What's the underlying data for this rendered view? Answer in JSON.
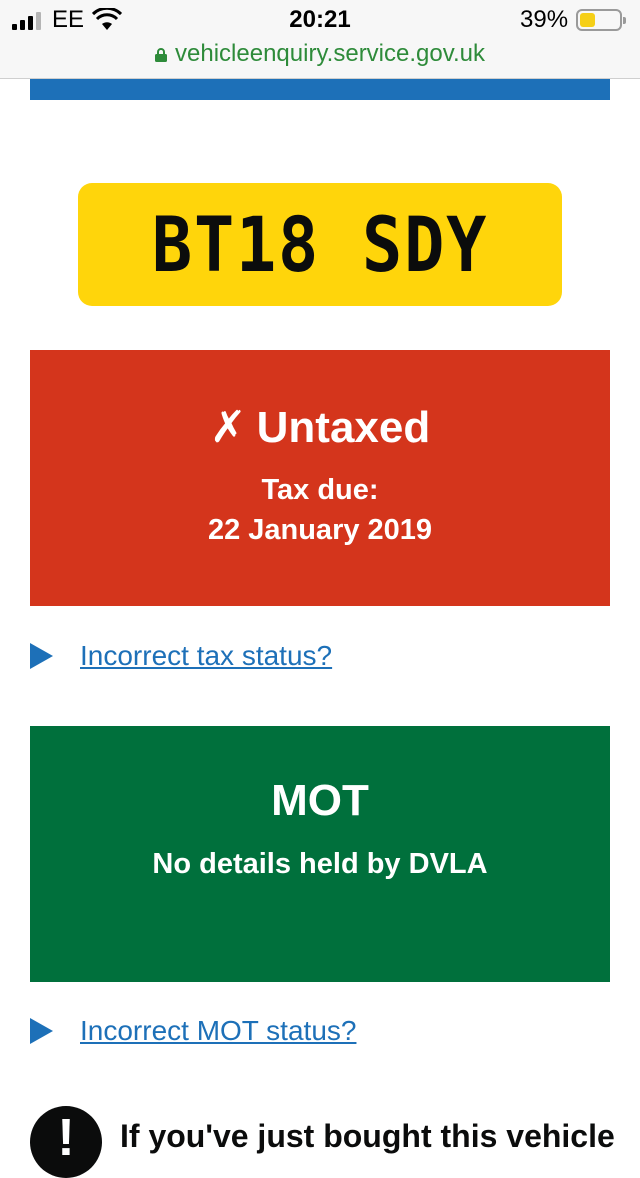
{
  "status_bar": {
    "carrier": "EE",
    "time": "20:21",
    "battery_percent": "39%",
    "battery_level": 0.39,
    "battery_color": "#f5cf17",
    "url": "vehicleenquiry.service.gov.uk"
  },
  "plate": {
    "registration": "BT18 SDY",
    "color": "#ffd50b"
  },
  "tax": {
    "icon": "cross-icon",
    "icon_glyph": "✗",
    "status": "Untaxed",
    "due_label": "Tax due:",
    "due_date": "22 January 2019",
    "color": "#d4351c"
  },
  "tax_help": {
    "link": "Incorrect tax status?"
  },
  "mot": {
    "title": "MOT",
    "text": "No details held by DVLA",
    "color": "#00703c"
  },
  "mot_help": {
    "link": "Incorrect MOT status?"
  },
  "notice": {
    "icon": "info-icon",
    "icon_glyph": "!",
    "text": "If you've just bought this vehicle"
  },
  "colors": {
    "link": "#1d70b8",
    "accent_strip": "#1d70b8"
  }
}
